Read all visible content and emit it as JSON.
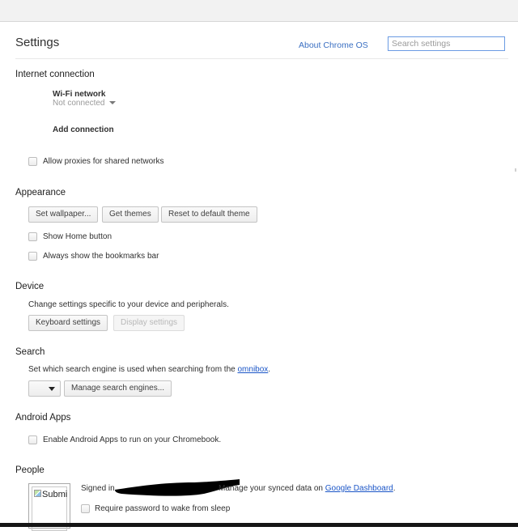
{
  "header": {
    "title": "Settings",
    "about_link": "About Chrome OS",
    "search_placeholder": "Search settings"
  },
  "internet": {
    "title": "Internet connection",
    "wifi_label": "Wi-Fi network",
    "wifi_status": "Not connected",
    "add_connection": "Add connection",
    "allow_proxies": "Allow proxies for shared networks"
  },
  "appearance": {
    "title": "Appearance",
    "set_wallpaper": "Set wallpaper...",
    "get_themes": "Get themes",
    "reset_theme": "Reset to default theme",
    "show_home": "Show Home button",
    "show_bookmarks": "Always show the bookmarks bar"
  },
  "device": {
    "title": "Device",
    "description": "Change settings specific to your device and peripherals.",
    "keyboard_settings": "Keyboard settings",
    "display_settings": "Display settings"
  },
  "search": {
    "title": "Search",
    "description_prefix": "Set which search engine is used when searching from the ",
    "omnibox_link": "omnibox",
    "description_suffix": ".",
    "manage_engines": "Manage search engines..."
  },
  "android": {
    "title": "Android Apps",
    "enable_label": "Enable Android Apps to run on your Chromebook."
  },
  "people": {
    "title": "People",
    "avatar_alt": "Submi",
    "signed_in_prefix": "Signed in",
    "manage_text": "Manage your synced data on ",
    "dashboard_link": "Google Dashboard",
    "manage_suffix": ".",
    "require_password": "Require password to wake from sleep"
  },
  "colors": {
    "link": "#1a55c7",
    "about_link": "#3a6fc2",
    "search_border": "#6b9be3"
  }
}
